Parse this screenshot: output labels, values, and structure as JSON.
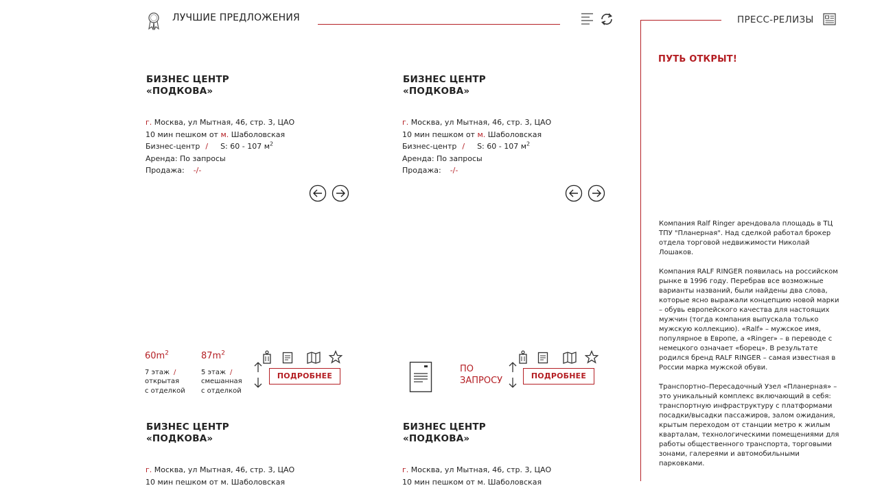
{
  "header": {
    "title": "ЛУЧШИЕ ПРЕДЛОЖЕНИЯ"
  },
  "press": {
    "title": "ПРЕСС-РЕЛИЗЫ",
    "headline": "ПУТЬ ОТКРЫТ!",
    "paragraphs": [
      "Компания Ralf Ringer арендовала площадь в ТЦ ТПУ \"Планерная\". Над сделкой работал брокер отдела торговой недвижимости Николай Лошаков.",
      "Компания RALF RINGER появилась на российском рынке в 1996 году. Перебрав все возможные варианты названий, были найдены два слова, которые ясно выражали концепцию новой марки – обувь европейского качества для настоящих мужчин (тогда компания выпускала только мужскую коллекцию). «Ralf» – мужское имя, популярное в Европе, а «Ringer» – в переводе с немецкого означает «борец». В результате родился бренд RALF RINGER – самая известная в России марка мужской обуви.",
      "Транспортно–Пересадочный Узел «Планерная» – это уникальный комплекс включающий в себя: транспортную инфраструктуру с платформами посадки/высадки пассажиров, залом ожидания, крытым переходом от станции метро к жилым кварталам, технологическими помещениями для работы общественного транспорта, торговыми зонами, галереями и автомобильными парковками."
    ]
  },
  "offers": [
    {
      "title_line1": "БИЗНЕС ЦЕНТР",
      "title_line2": "«ПОДКОВА»",
      "city_prefix": "г.",
      "address": "Москва, ул Мытная, 46, стр. 3, ЦАО",
      "walk_text": "10 мин пешком от",
      "metro_prefix": "м.",
      "metro": "Шаболовская",
      "type": "Бизнес-центр",
      "slash": "/",
      "area_label": "S: 60 - 107 м",
      "area_sup": "2",
      "rent": "Аренда: По запросы",
      "sale_label": "Продажа:",
      "sale_value": "-/-"
    },
    {
      "title_line1": "БИЗНЕС ЦЕНТР",
      "title_line2": "«ПОДКОВА»",
      "city_prefix": "г.",
      "address": "Москва, ул Мытная, 46, стр. 3, ЦАО",
      "walk_text": "10 мин пешком от",
      "metro_prefix": "м.",
      "metro": "Шаболовская",
      "type": "Бизнес-центр",
      "slash": "/",
      "area_label": "S: 60 - 107 м",
      "area_sup": "2",
      "rent": "Аренда: По запросы",
      "sale_label": "Продажа:",
      "sale_value": "-/-"
    }
  ],
  "units_left": [
    {
      "area": "60m",
      "sup": "2",
      "floor": "7 этаж",
      "slash": "/",
      "finish1": "открытая",
      "finish2": "с отделкой"
    },
    {
      "area": "87m",
      "sup": "2",
      "floor": "5 этаж",
      "slash": "/",
      "finish1": "смешанная",
      "finish2": "с отделкой"
    }
  ],
  "request_text_1": "ПО",
  "request_text_2": "ЗАПРОСУ",
  "more_label": "ПОДРОБНЕЕ",
  "next_offers": [
    {
      "title_line1": "БИЗНЕС ЦЕНТР",
      "title_line2": "«ПОДКОВА»",
      "city_prefix": "г.",
      "address": "Москва, ул Мытная, 46, стр. 3, ЦАО",
      "walk_text": "10 мин пешком от м. Шаболовская"
    },
    {
      "title_line1": "БИЗНЕС ЦЕНТР",
      "title_line2": "«ПОДКОВА»",
      "city_prefix": "г.",
      "address": "Москва, ул Мытная, 46, стр. 3, ЦАО",
      "walk_text": "10 мин пешком от м. Шаболовская"
    }
  ],
  "colors": {
    "accent": "#b41e23",
    "text": "#222222"
  }
}
